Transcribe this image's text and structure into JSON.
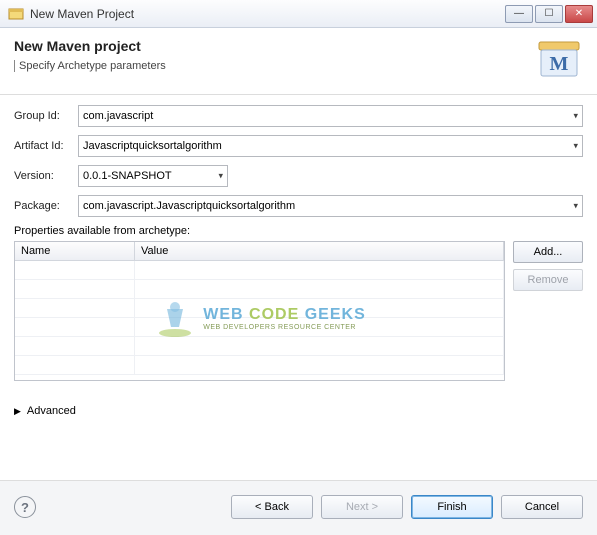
{
  "titlebar": {
    "title": "New Maven Project"
  },
  "header": {
    "title": "New Maven project",
    "subtitle": "Specify Archetype parameters"
  },
  "labels": {
    "groupId": "Group Id:",
    "artifactId": "Artifact Id:",
    "version": "Version:",
    "package": "Package:",
    "propertiesSection": "Properties available from archetype:",
    "advanced": "Advanced"
  },
  "values": {
    "groupId": "com.javascript",
    "artifactId": "Javascriptquicksortalgorithm",
    "version": "0.0.1-SNAPSHOT",
    "package": "com.javascript.Javascriptquicksortalgorithm"
  },
  "table": {
    "headers": {
      "name": "Name",
      "value": "Value"
    }
  },
  "sideButtons": {
    "add": "Add...",
    "remove": "Remove"
  },
  "footer": {
    "back": "< Back",
    "next": "Next >",
    "finish": "Finish",
    "cancel": "Cancel"
  },
  "watermark": {
    "main": "WEB CODE GEEKS",
    "sub": "WEB DEVELOPERS RESOURCE CENTER"
  }
}
